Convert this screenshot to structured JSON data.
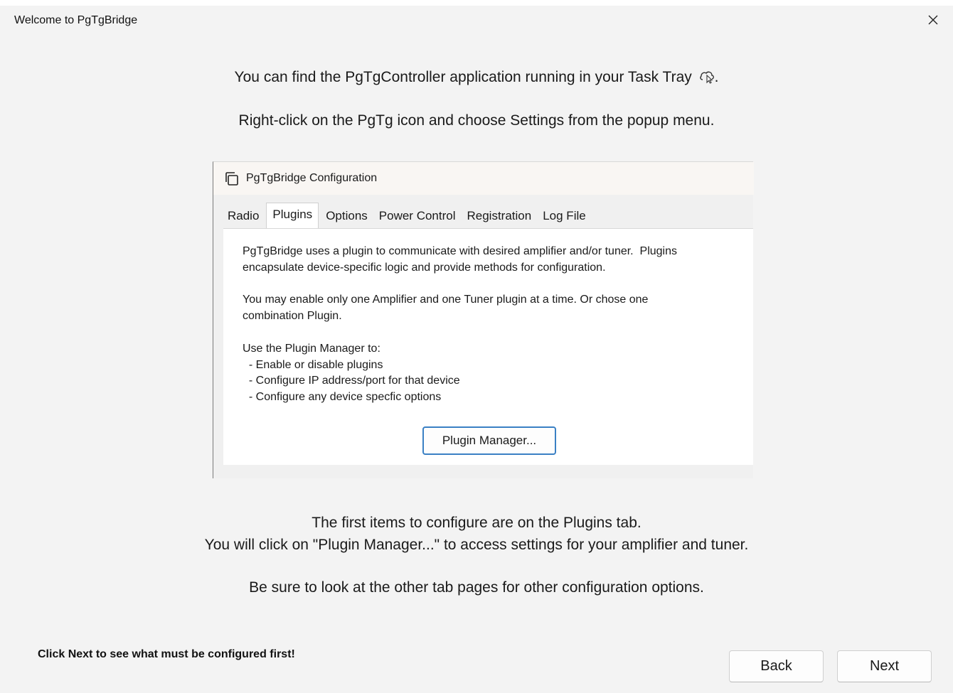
{
  "window": {
    "title": "Welcome to PgTgBridge",
    "close_glyph": "✕"
  },
  "intro": {
    "line1": "You can find the PgTgController application running in your Task Tray",
    "line1_suffix": ".",
    "tray_icon": "cloud-pointer-icon",
    "line2": "Right-click on the PgTg icon and choose Settings from the popup menu."
  },
  "config_shot": {
    "title": "PgTgBridge Configuration",
    "tabs": [
      {
        "label": "Radio",
        "active": false
      },
      {
        "label": "Plugins",
        "active": true
      },
      {
        "label": "Options",
        "active": false
      },
      {
        "label": "Power Control",
        "active": false
      },
      {
        "label": "Registration",
        "active": false
      },
      {
        "label": "Log File",
        "active": false
      }
    ],
    "paragraph1": "PgTgBridge uses a plugin to communicate with desired amplifier and/or tuner.  Plugins\nencapsulate device-specific logic and provide methods for configuration.",
    "paragraph2": "You may enable only one Amplifier and one Tuner plugin at a time. Or chose one\ncombination Plugin.",
    "paragraph3": "Use the Plugin Manager to:\n  - Enable or disable plugins\n  - Configure IP address/port for that device\n  - Configure any device specfic options",
    "plugin_manager_button": "Plugin Manager..."
  },
  "outro": {
    "line1": "The first items to configure are on the Plugins tab.",
    "line2": "You will click on \"Plugin Manager...\" to access settings for your amplifier and tuner.",
    "line3": "Be sure to look at the other tab pages for other configuration options."
  },
  "footer": {
    "note": "Click Next to see what must be configured first!",
    "back_label": "Back",
    "next_label": "Next"
  }
}
